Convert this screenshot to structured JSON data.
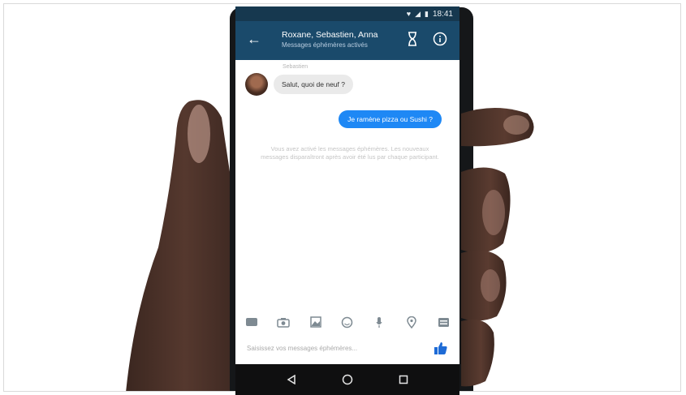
{
  "status_bar": {
    "time": "18:41"
  },
  "app_bar": {
    "title": "Roxane, Sebastien, Anna",
    "subtitle": "Messages éphémères activés"
  },
  "messages": {
    "sender_name": "Sebastien",
    "incoming_text": "Salut, quoi de neuf ?",
    "outgoing_text": "Je ramène pizza ou Sushi ?",
    "system_text": "Vous avez activé les messages éphémères. Les nouveaux messages disparaîtront après avoir été lus par chaque participant."
  },
  "composer": {
    "placeholder": "Saisissez vos messages éphémères..."
  },
  "icons": {
    "status": [
      "heart-icon",
      "signal-icon",
      "battery-icon"
    ],
    "app_bar": [
      "back-arrow-icon",
      "hourglass-icon",
      "info-icon"
    ],
    "toolbar": [
      "gif-icon",
      "camera-icon",
      "gallery-icon",
      "emoji-icon",
      "microphone-icon",
      "location-icon",
      "more-icon"
    ],
    "composer": [
      "thumbs-up-icon"
    ],
    "nav": [
      "back-triangle-icon",
      "home-circle-icon",
      "recent-square-icon"
    ]
  },
  "colors": {
    "app_bar": "#1a4a6b",
    "outgoing_bubble": "#1e88f5",
    "incoming_bubble": "#eaeaea",
    "skin": "#4a3128"
  }
}
